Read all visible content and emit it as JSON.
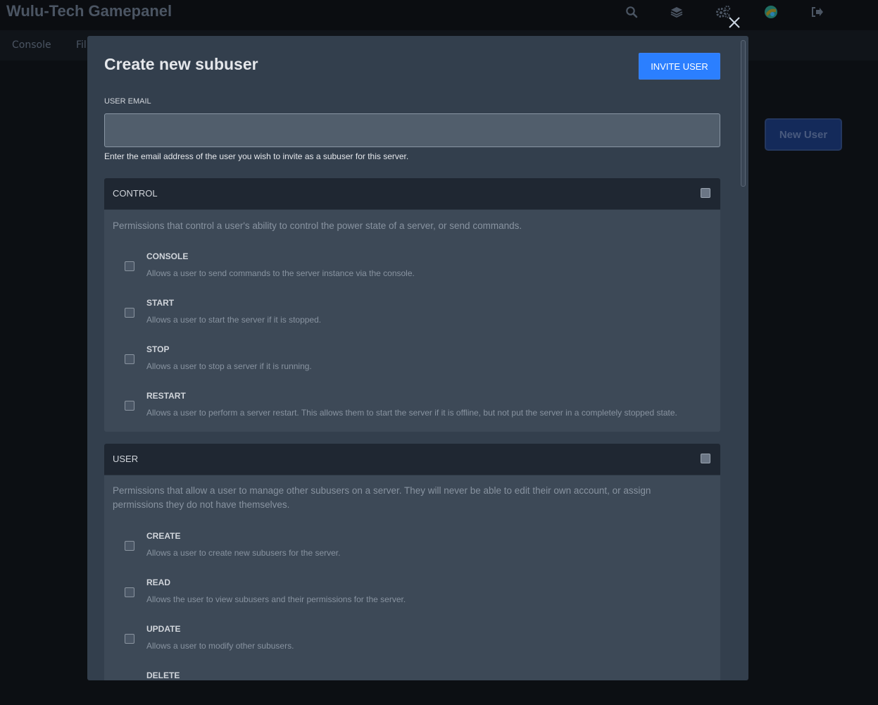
{
  "navbar": {
    "brand": "Wulu-Tech Gamepanel",
    "icons": [
      "search-icon",
      "layers-icon",
      "cogs-icon",
      "avatar-icon",
      "logout-icon"
    ]
  },
  "subnav": {
    "tabs": [
      {
        "label": "Console"
      },
      {
        "label": "Fil"
      }
    ]
  },
  "page": {
    "new_user_label": "New User"
  },
  "modal": {
    "title": "Create new subuser",
    "invite_label": "INVITE USER",
    "email": {
      "label": "USER EMAIL",
      "value": "",
      "placeholder": "",
      "help": "Enter the email address of the user you wish to invite as a subuser for this server."
    },
    "groups": [
      {
        "title": "CONTROL",
        "description": "Permissions that control a user's ability to control the power state of a server, or send commands.",
        "permissions": [
          {
            "name": "CONSOLE",
            "description": "Allows a user to send commands to the server instance via the console."
          },
          {
            "name": "START",
            "description": "Allows a user to start the server if it is stopped."
          },
          {
            "name": "STOP",
            "description": "Allows a user to stop a server if it is running."
          },
          {
            "name": "RESTART",
            "description": "Allows a user to perform a server restart. This allows them to start the server if it is offline, but not put the server in a completely stopped state."
          }
        ]
      },
      {
        "title": "USER",
        "description": "Permissions that allow a user to manage other subusers on a server. They will never be able to edit their own account, or assign permissions they do not have themselves.",
        "permissions": [
          {
            "name": "CREATE",
            "description": "Allows a user to create new subusers for the server."
          },
          {
            "name": "READ",
            "description": "Allows the user to view subusers and their permissions for the server."
          },
          {
            "name": "UPDATE",
            "description": "Allows a user to modify other subusers."
          },
          {
            "name": "DELETE",
            "description": ""
          }
        ]
      }
    ]
  },
  "colors": {
    "accent": "#2b7fff",
    "modal_bg": "#333f4d",
    "group_header": "#1f2732"
  }
}
